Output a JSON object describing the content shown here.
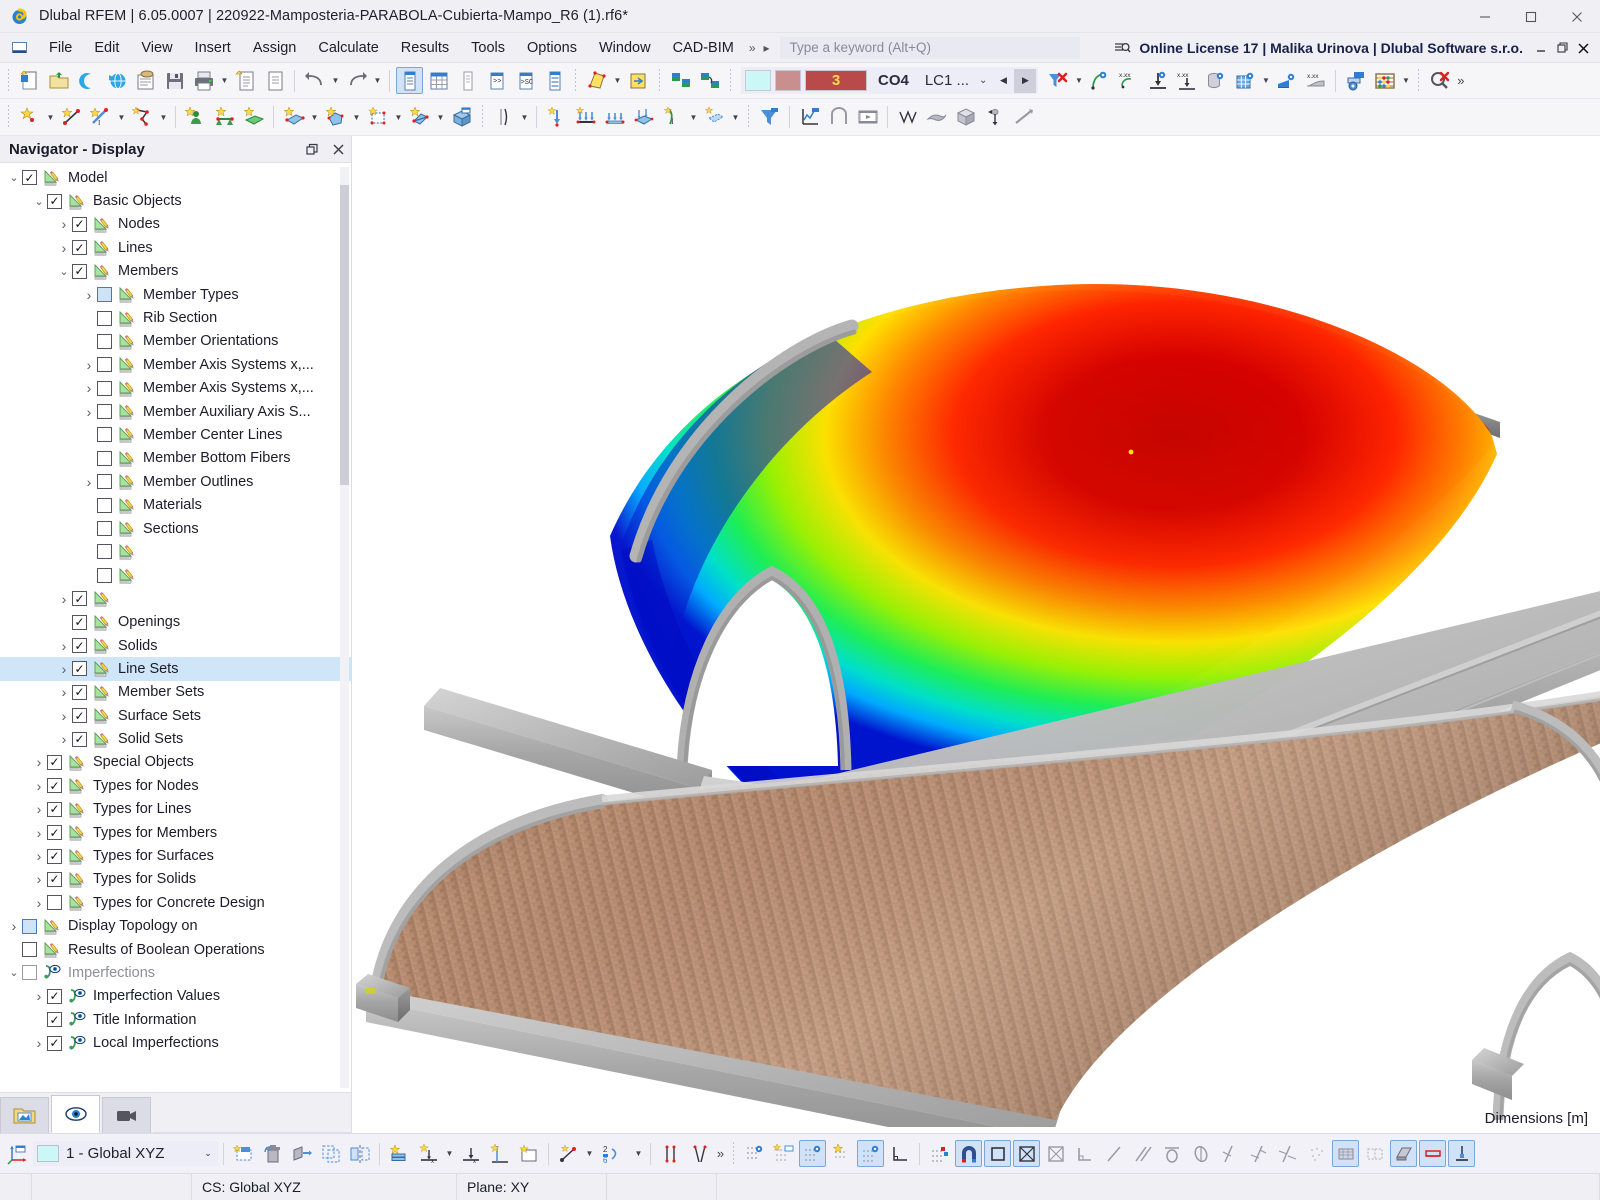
{
  "window": {
    "title": "Dlubal RFEM | 6.05.0007 | 220922-Mamposteria-PARABOLA-Cubierta-Mampo_R6 (1).rf6*",
    "app_icon": "dlubal-logo-icon",
    "minimize": "–",
    "maximize": "☐",
    "close": "✕"
  },
  "menu": {
    "items": [
      {
        "label": "File"
      },
      {
        "label": "Edit"
      },
      {
        "label": "View"
      },
      {
        "label": "Insert"
      },
      {
        "label": "Assign"
      },
      {
        "label": "Calculate"
      },
      {
        "label": "Results"
      },
      {
        "label": "Tools"
      },
      {
        "label": "Options"
      },
      {
        "label": "Window"
      },
      {
        "label": "CAD-BIM"
      }
    ],
    "overflow": "»",
    "play": "▸",
    "search_placeholder": "Type a keyword (Alt+Q)",
    "license": "Online License 17 | Malika Urinova | Dlubal Software s.r.o.",
    "mini_minimize": "–",
    "mini_restore": "❐",
    "mini_close": "✕"
  },
  "toolbar_main": {
    "groups": [
      {
        "buttons": [
          {
            "name": "new-model-button",
            "icon": "new-document-icon"
          },
          {
            "name": "open-button",
            "icon": "open-folder-icon"
          },
          {
            "name": "cloud-button",
            "icon": "cloud-icon"
          },
          {
            "name": "webservice-button",
            "icon": "globe-blue-icon"
          },
          {
            "name": "save-project-button",
            "icon": "save-project-icon"
          },
          {
            "name": "save-button",
            "icon": "floppy-disk-icon"
          },
          {
            "name": "print-button",
            "icon": "printer-icon",
            "caret": true
          },
          {
            "name": "printout-report-button",
            "icon": "report-new-icon"
          },
          {
            "name": "document-button",
            "icon": "document-icon"
          }
        ]
      },
      {
        "buttons": [
          {
            "name": "undo-button",
            "icon": "undo-arrow-icon",
            "caret": true
          },
          {
            "name": "redo-button",
            "icon": "redo-arrow-icon",
            "caret": true
          }
        ]
      },
      {
        "buttons": [
          {
            "name": "navigator-button",
            "icon": "navigator-panel-icon",
            "active": true
          },
          {
            "name": "table-button",
            "icon": "table-grid-icon"
          },
          {
            "name": "list-panel-button",
            "icon": "list-panel-icon"
          },
          {
            "name": "console-button",
            "icon": "console-icon"
          },
          {
            "name": "script-button",
            "icon": "script-sc-icon"
          },
          {
            "name": "properties-button",
            "icon": "properties-panel-icon"
          }
        ]
      },
      {
        "buttons": [
          {
            "name": "render-style-button",
            "icon": "render-style-icon",
            "caret": true
          },
          {
            "name": "visibility-button",
            "icon": "visibility-box-icon"
          }
        ]
      },
      {
        "buttons": [
          {
            "name": "model-check-button",
            "icon": "model-check-icon"
          },
          {
            "name": "regenerate-button",
            "icon": "regenerate-icon"
          }
        ]
      }
    ],
    "load_case": {
      "swatch_cool": "#ccf7f7",
      "swatch_warm": "#c98f8f",
      "count_badge": "3",
      "count_color": "#b94a4a",
      "combination": "CO4",
      "loadcase": "LC1 ...",
      "prev_arrow": "◀",
      "next_arrow": "▶"
    },
    "right_buttons": [
      {
        "name": "filter-clear-button",
        "icon": "filter-x-icon",
        "caret": true
      },
      {
        "name": "result-values-button",
        "icon": "result-values-icon"
      },
      {
        "name": "show-values-button",
        "icon": "xxx-values-icon"
      },
      {
        "name": "support-reactions-button",
        "icon": "support-reaction-icon"
      },
      {
        "name": "deformation-button",
        "icon": "deformation-icon"
      },
      {
        "name": "solid-results-button",
        "icon": "solid-results-icon"
      },
      {
        "name": "surface-results-button",
        "icon": "surface-grid-icon",
        "caret": true
      },
      {
        "name": "diagram-results-button",
        "icon": "diagram-results-icon"
      },
      {
        "name": "smoothing-button",
        "icon": "smoothing-icon"
      },
      {
        "name": "result-config-button",
        "icon": "result-config-icon"
      },
      {
        "name": "calculation-button",
        "icon": "abacus-icon",
        "caret": true
      },
      {
        "name": "clear-results-button",
        "icon": "clear-results-icon"
      }
    ],
    "overflow": "»"
  },
  "toolbar_secondary": {
    "buttons": [
      {
        "name": "new-node-button",
        "icon": "node-star-icon",
        "caret": true
      },
      {
        "name": "new-line-button",
        "icon": "line-star-icon"
      },
      {
        "name": "new-line-variant-button",
        "icon": "line-variant-icon",
        "caret": true
      },
      {
        "name": "new-polyline-button",
        "icon": "polyline-icon",
        "caret": true
      },
      {
        "name": "new-support-button",
        "icon": "nodal-support-icon"
      },
      {
        "name": "new-line-support-button",
        "icon": "line-support-icon"
      },
      {
        "name": "new-surface-support-button",
        "icon": "surface-support-icon"
      },
      {
        "name": "new-surface-button",
        "icon": "surface-star-icon",
        "caret": true
      },
      {
        "name": "new-solid-button",
        "icon": "solid-star-icon",
        "caret": true
      },
      {
        "name": "new-opening-button",
        "icon": "opening-icon",
        "caret": true
      },
      {
        "name": "new-member-button",
        "icon": "member-star-icon",
        "caret": true
      },
      {
        "name": "new-block-button",
        "icon": "block-icon"
      },
      {
        "name": "new-imperfection-button",
        "icon": "imperfection-icon",
        "caret": true
      },
      {
        "name": "new-nodal-load-button",
        "icon": "nodal-load-icon"
      },
      {
        "name": "new-member-load-button",
        "icon": "member-load-icon"
      },
      {
        "name": "new-line-load-button",
        "icon": "line-load-icon"
      },
      {
        "name": "new-surface-load-button",
        "icon": "surface-load-icon"
      },
      {
        "name": "new-free-load-button",
        "icon": "free-load-icon",
        "caret": true
      },
      {
        "name": "new-area-load-button",
        "icon": "area-load-icon",
        "caret": true
      },
      {
        "name": "load-wizard-button",
        "icon": "load-wizard-icon"
      },
      {
        "name": "load-diagram-button",
        "icon": "load-diagram-icon"
      },
      {
        "name": "load-frame-button",
        "icon": "load-frame-icon"
      },
      {
        "name": "animation-button",
        "icon": "film-strip-icon"
      },
      {
        "name": "mesh-button",
        "icon": "mesh-icon"
      },
      {
        "name": "shading-button",
        "icon": "shading-icon"
      },
      {
        "name": "view-cube-button",
        "icon": "view-cube-icon"
      },
      {
        "name": "move-button",
        "icon": "move-icon"
      },
      {
        "name": "measure-button",
        "icon": "measure-icon"
      },
      {
        "name": "dimension-button",
        "icon": "dimension-icon"
      },
      {
        "name": "angle-dim-button",
        "icon": "angle-dimension-icon"
      },
      {
        "name": "arc-dim-button",
        "icon": "arc-dimension-icon"
      },
      {
        "name": "radius-dim-button",
        "icon": "radius-dimension-icon"
      },
      {
        "name": "slope-dim-button",
        "icon": "slope-dimension-icon"
      },
      {
        "name": "curve-dim-button",
        "icon": "curve-dimension-icon"
      },
      {
        "name": "vertical-dim-button",
        "icon": "vertical-dimension-icon"
      },
      {
        "name": "text-annotation-button",
        "icon": "text-annotation-icon",
        "caret": true
      },
      {
        "name": "grid-snap-button",
        "icon": "grid-snap-icon"
      }
    ]
  },
  "navigator": {
    "title": "Navigator - Display",
    "restore_icon": "❐",
    "close_icon": "✕",
    "tree": [
      {
        "label": "Model",
        "depth": 0,
        "exp": "down",
        "check": "checked",
        "icon": "display-pencil-icon"
      },
      {
        "label": "Basic Objects",
        "depth": 1,
        "exp": "down",
        "check": "checked",
        "icon": "display-pencil-icon"
      },
      {
        "label": "Nodes",
        "depth": 2,
        "exp": "right",
        "check": "checked",
        "icon": "display-pencil-icon"
      },
      {
        "label": "Lines",
        "depth": 2,
        "exp": "right",
        "check": "checked",
        "icon": "display-pencil-icon"
      },
      {
        "label": "Members",
        "depth": 2,
        "exp": "down",
        "check": "checked",
        "icon": "display-pencil-icon"
      },
      {
        "label": "Member Types",
        "depth": 3,
        "exp": "right",
        "check": "tri",
        "icon": "display-pencil-icon"
      },
      {
        "label": "Rib Section",
        "depth": 3,
        "exp": "none",
        "check": "empty",
        "icon": "display-pencil-icon"
      },
      {
        "label": "Member Orientations",
        "depth": 3,
        "exp": "none",
        "check": "empty",
        "icon": "display-pencil-icon"
      },
      {
        "label": "Member Axis Systems x,...",
        "depth": 3,
        "exp": "right",
        "check": "empty",
        "icon": "display-pencil-icon"
      },
      {
        "label": "Member Axis Systems x,...",
        "depth": 3,
        "exp": "right",
        "check": "empty",
        "icon": "display-pencil-icon"
      },
      {
        "label": "Member Auxiliary Axis S...",
        "depth": 3,
        "exp": "right",
        "check": "empty",
        "icon": "display-pencil-icon"
      },
      {
        "label": "Member Center Lines",
        "depth": 3,
        "exp": "none",
        "check": "empty",
        "icon": "display-pencil-icon"
      },
      {
        "label": "Member Bottom Fibers",
        "depth": 3,
        "exp": "none",
        "check": "empty",
        "icon": "display-pencil-icon"
      },
      {
        "label": "Member Outlines",
        "depth": 3,
        "exp": "right",
        "check": "empty",
        "icon": "display-pencil-icon"
      },
      {
        "label": "Materials",
        "depth": 3,
        "exp": "none",
        "check": "empty",
        "icon": "display-pencil-icon"
      },
      {
        "label": "Sections",
        "depth": 3,
        "exp": "none",
        "check": "empty",
        "icon": "display-pencil-icon"
      },
      {
        "label": "",
        "depth": 3,
        "exp": "none",
        "check": "empty",
        "icon": "display-pencil-icon"
      },
      {
        "label": "",
        "depth": 3,
        "exp": "none",
        "check": "empty",
        "icon": "display-pencil-icon"
      },
      {
        "label": "",
        "depth": 2,
        "exp": "right",
        "check": "checked",
        "icon": "display-pencil-icon"
      },
      {
        "label": "Openings",
        "depth": 2,
        "exp": "none",
        "check": "checked",
        "icon": "display-pencil-icon"
      },
      {
        "label": "Solids",
        "depth": 2,
        "exp": "right",
        "check": "checked",
        "icon": "display-pencil-icon"
      },
      {
        "label": "Line Sets",
        "depth": 2,
        "exp": "right",
        "check": "checked",
        "icon": "display-pencil-icon",
        "selected": true
      },
      {
        "label": "Member Sets",
        "depth": 2,
        "exp": "right",
        "check": "checked",
        "icon": "display-pencil-icon"
      },
      {
        "label": "Surface Sets",
        "depth": 2,
        "exp": "right",
        "check": "checked",
        "icon": "display-pencil-icon"
      },
      {
        "label": "Solid Sets",
        "depth": 2,
        "exp": "right",
        "check": "checked",
        "icon": "display-pencil-icon"
      },
      {
        "label": "Special Objects",
        "depth": 1,
        "exp": "right",
        "check": "checked",
        "icon": "display-pencil-icon"
      },
      {
        "label": "Types for Nodes",
        "depth": 1,
        "exp": "right",
        "check": "checked",
        "icon": "display-pencil-icon"
      },
      {
        "label": "Types for Lines",
        "depth": 1,
        "exp": "right",
        "check": "checked",
        "icon": "display-pencil-icon"
      },
      {
        "label": "Types for Members",
        "depth": 1,
        "exp": "right",
        "check": "checked",
        "icon": "display-pencil-icon"
      },
      {
        "label": "Types for Surfaces",
        "depth": 1,
        "exp": "right",
        "check": "checked",
        "icon": "display-pencil-icon"
      },
      {
        "label": "Types for Solids",
        "depth": 1,
        "exp": "right",
        "check": "checked",
        "icon": "display-pencil-icon"
      },
      {
        "label": "Types for Concrete Design",
        "depth": 1,
        "exp": "right",
        "check": "empty",
        "icon": "display-pencil-icon"
      },
      {
        "label": "Display Topology on",
        "depth": 0,
        "exp": "right",
        "check": "tri",
        "icon": "display-pencil-icon"
      },
      {
        "label": "Results of Boolean Operations",
        "depth": 0,
        "exp": "none",
        "check": "empty",
        "icon": "display-pencil-icon"
      },
      {
        "label": "Imperfections",
        "depth": 0,
        "exp": "down",
        "check": "empty",
        "icon": "imperfection-eye-icon",
        "dim": true
      },
      {
        "label": "Imperfection Values",
        "depth": 1,
        "exp": "right",
        "check": "checked",
        "icon": "imperfection-eye-icon"
      },
      {
        "label": "Title Information",
        "depth": 1,
        "exp": "none",
        "check": "checked",
        "icon": "imperfection-eye-icon"
      },
      {
        "label": "Local Imperfections",
        "depth": 1,
        "exp": "right",
        "check": "checked",
        "icon": "imperfection-eye-icon"
      }
    ],
    "tabs": [
      {
        "name": "tab-navigator-project",
        "icon": "project-folder-icon",
        "selected": false
      },
      {
        "name": "tab-navigator-display",
        "icon": "eye-icon",
        "selected": true
      },
      {
        "name": "tab-navigator-views",
        "icon": "video-camera-icon",
        "selected": false
      }
    ]
  },
  "viewport": {
    "dimensions_label": "Dimensions [m]",
    "result_colors": [
      "#0000cc",
      "#0060ff",
      "#00c8f0",
      "#00e8c0",
      "#3df03d",
      "#aaf000",
      "#ffe000",
      "#ff9000",
      "#ff2800",
      "#c40000"
    ],
    "masonry_color": "#b98a6e",
    "structure_color": "#a8a8a8"
  },
  "toolbar_bottom": {
    "cs_icon": "coordinate-system-icon",
    "cs_value": "1 - Global XYZ",
    "buttons": [
      {
        "name": "snap-new-button",
        "icon": "snap-new-icon"
      },
      {
        "name": "delete-object-button",
        "icon": "delete-object-icon"
      },
      {
        "name": "extrude-button",
        "icon": "extrude-icon"
      },
      {
        "name": "copy-object-button",
        "icon": "copy-object-icon"
      },
      {
        "name": "mirror-object-button",
        "icon": "mirror-object-icon"
      },
      {
        "name": "stack-button",
        "icon": "stack-icon"
      },
      {
        "name": "align-x-button",
        "icon": "align-x-icon",
        "caret": true
      },
      {
        "name": "align-ix-button",
        "icon": "align-ix-icon"
      },
      {
        "name": "project-button",
        "icon": "project-icon"
      },
      {
        "name": "frame-select-button",
        "icon": "frame-select-icon"
      },
      {
        "name": "connect-points-button",
        "icon": "connect-points-icon",
        "caret": true
      },
      {
        "name": "divide-button",
        "icon": "divide-2-6-icon",
        "caret": true
      },
      {
        "name": "split-vertical-button",
        "icon": "split-vertical-icon"
      },
      {
        "name": "split-angle-button",
        "icon": "split-angle-icon"
      },
      {
        "name": "overflow-button",
        "icon": "overflow-icon"
      }
    ],
    "view_buttons": [
      {
        "name": "grid-display-button",
        "icon": "grid-dots-icon"
      },
      {
        "name": "grid-snap-button",
        "icon": "grid-snap-yellow-icon"
      },
      {
        "name": "osnap-button",
        "icon": "osnap-icon",
        "active": true
      },
      {
        "name": "snap-star-button",
        "icon": "snap-star-icon"
      },
      {
        "name": "snap-point-button",
        "icon": "snap-point-icon",
        "active": true
      },
      {
        "name": "ortho-button",
        "icon": "ortho-icon"
      },
      {
        "name": "snap-node-button",
        "icon": "snap-node-icon"
      },
      {
        "name": "snap-magnet-button",
        "icon": "snap-magnet-icon",
        "active": true
      },
      {
        "name": "snap-rect-button",
        "icon": "snap-rect-icon",
        "active": true
      },
      {
        "name": "snap-center-button",
        "icon": "snap-center-icon",
        "active": true
      },
      {
        "name": "snap-box-button",
        "icon": "snap-box-icon"
      },
      {
        "name": "snap-corner-button",
        "icon": "snap-corner-icon"
      },
      {
        "name": "snap-line-button",
        "icon": "snap-line-icon"
      },
      {
        "name": "snap-parallel-button",
        "icon": "snap-parallel-icon"
      },
      {
        "name": "snap-tangent-button",
        "icon": "snap-tangent-icon"
      },
      {
        "name": "snap-quadrant-button",
        "icon": "snap-quadrant-icon"
      },
      {
        "name": "snap-perp-button",
        "icon": "snap-perpendicular-icon"
      },
      {
        "name": "snap-extend-button",
        "icon": "snap-extend-icon"
      },
      {
        "name": "snap-intersect-button",
        "icon": "snap-intersect-icon"
      },
      {
        "name": "snap-nearest-button",
        "icon": "snap-nearest-icon"
      },
      {
        "name": "work-plane-button",
        "icon": "work-plane-icon",
        "active": true
      },
      {
        "name": "work-grid-button",
        "icon": "work-grid-icon"
      },
      {
        "name": "render-solid-button",
        "icon": "render-solid-icon",
        "active": true
      },
      {
        "name": "render-wire-button",
        "icon": "render-wire-icon",
        "active": true
      },
      {
        "name": "render-support-button",
        "icon": "render-support-icon",
        "active": true
      }
    ]
  },
  "statusbar": {
    "cells": [
      {
        "name": "status-cs",
        "text": "CS: Global XYZ"
      },
      {
        "name": "status-plane",
        "text": "Plane: XY"
      },
      {
        "name": "status-empty-1",
        "text": ""
      },
      {
        "name": "status-empty-2",
        "text": ""
      }
    ]
  }
}
